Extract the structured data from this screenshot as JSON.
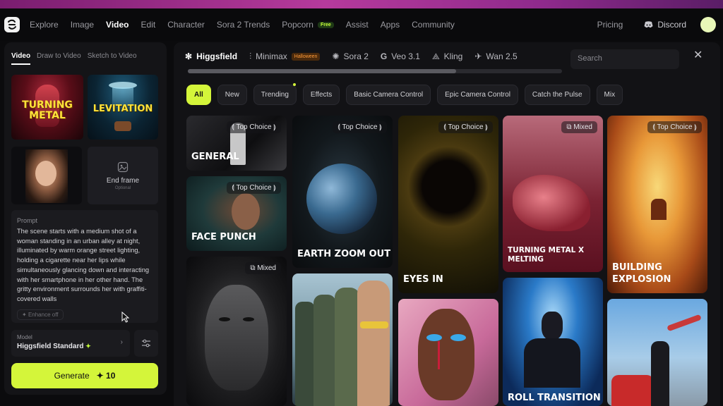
{
  "nav": {
    "items": [
      "Explore",
      "Image",
      "Video",
      "Edit",
      "Character",
      "Sora 2 Trends",
      "Popcorn",
      "Assist",
      "Apps",
      "Community"
    ],
    "active": "Video",
    "popcorn_badge": "Free",
    "pricing": "Pricing",
    "discord": "Discord"
  },
  "left": {
    "tabs": [
      "Video",
      "Draw to Video",
      "Sketch to Video"
    ],
    "thumb1_text": "TURNING METAL",
    "thumb2_text": "LEVITATION",
    "end_frame": {
      "label": "End frame",
      "hint": "Optional"
    },
    "prompt": {
      "label": "Prompt",
      "text": "The scene starts with a medium shot of a woman standing in an urban alley at night, illuminated by warm orange street lighting, holding a cigarette near her lips while simultaneously glancing down and interacting with her smartphone in her other hand. The gritty environment surrounds her with graffiti-covered walls",
      "enhance": "Enhance off"
    },
    "model": {
      "label": "Model",
      "value": "Higgsfield Standard"
    },
    "generate": {
      "label": "Generate",
      "cost": "10"
    }
  },
  "models": {
    "tabs": [
      {
        "label": "Higgsfield",
        "active": true,
        "icon": "higgsfield-icon"
      },
      {
        "label": "Minimax",
        "badge": "Halloween",
        "icon": "minimax-icon"
      },
      {
        "label": "Sora 2",
        "icon": "openai-icon"
      },
      {
        "label": "Veo 3.1",
        "icon": "google-icon"
      },
      {
        "label": "Kling",
        "icon": "kling-icon"
      },
      {
        "label": "Wan 2.5",
        "icon": "wan-icon"
      }
    ],
    "search_placeholder": "Search"
  },
  "chips": [
    "All",
    "New",
    "Trending",
    "Effects",
    "Basic Camera Control",
    "Epic Camera Control",
    "Catch the Pulse",
    "Mix"
  ],
  "cards": [
    {
      "title": "GENERAL",
      "badge": "Top Choice"
    },
    {
      "title": "FACE PUNCH",
      "badge": "Top Choice"
    },
    {
      "title": "",
      "badge": "Mixed"
    },
    {
      "title": "EARTH ZOOM OUT",
      "badge": "Top Choice"
    },
    {
      "title": "",
      "badge": ""
    },
    {
      "title": "EYES IN",
      "badge": "Top Choice"
    },
    {
      "title": "",
      "badge": ""
    },
    {
      "title": "TURNING METAL X MELTING",
      "badge": "Mixed"
    },
    {
      "title": "ROLL TRANSITION",
      "badge": ""
    },
    {
      "title": "BUILDING EXPLOSION",
      "badge": "Top Choice"
    },
    {
      "title": "",
      "badge": ""
    }
  ],
  "colors": {
    "accent": "#d4f53a",
    "panel": "#141417",
    "background": "#0b0b0d"
  }
}
